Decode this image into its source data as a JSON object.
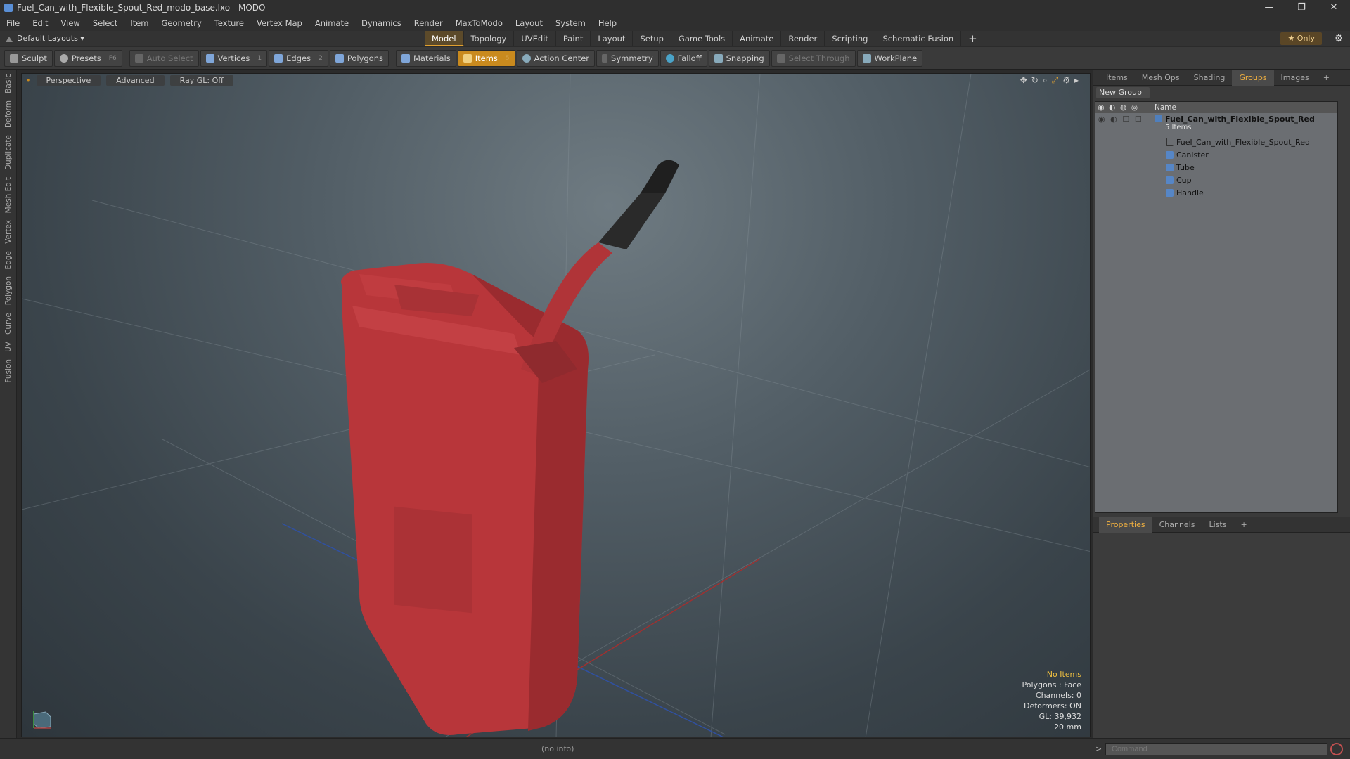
{
  "window": {
    "title": "Fuel_Can_with_Flexible_Spout_Red_modo_base.lxo - MODO",
    "minimize": "—",
    "restore": "❐",
    "close": "✕"
  },
  "menu": [
    "File",
    "Edit",
    "View",
    "Select",
    "Item",
    "Geometry",
    "Texture",
    "Vertex Map",
    "Animate",
    "Dynamics",
    "Render",
    "MaxToModo",
    "Layout",
    "System",
    "Help"
  ],
  "layoutbar": {
    "layout_dropdown": "Default Layouts ▾",
    "tabs": [
      "Model",
      "Topology",
      "UVEdit",
      "Paint",
      "Layout",
      "Setup",
      "Game Tools",
      "Animate",
      "Render",
      "Scripting",
      "Schematic Fusion"
    ],
    "active_tab": "Model",
    "add_tab": "+",
    "only_label": "★  Only",
    "gear": "⚙"
  },
  "toolbar": {
    "sculpt": "Sculpt",
    "presets": "Presets",
    "presets_key": "F6",
    "auto_select": "Auto Select",
    "vertices": "Vertices",
    "vertices_count": "1",
    "edges": "Edges",
    "edges_count": "2",
    "polygons": "Polygons",
    "materials": "Materials",
    "items": "Items",
    "items_count": "5",
    "action_center": "Action Center",
    "symmetry": "Symmetry",
    "falloff": "Falloff",
    "snapping": "Snapping",
    "select_through": "Select Through",
    "workplane": "WorkPlane"
  },
  "left_tabs": [
    "Basic",
    "Deform",
    "Duplicate",
    "Mesh Edit",
    "Vertex",
    "Edge",
    "Polygon",
    "Curve",
    "UV",
    "Fusion"
  ],
  "viewport": {
    "view_mode": "Perspective",
    "shading": "Advanced",
    "raygl": "Ray GL: Off",
    "info": {
      "no_items": "No Items",
      "polygons": "Polygons : Face",
      "channels": "Channels: 0",
      "deformers": "Deformers: ON",
      "gl": "GL: 39,932",
      "scale": "20 mm"
    }
  },
  "right_panel": {
    "tabs": [
      "Items",
      "Mesh Ops",
      "Shading",
      "Groups",
      "Images",
      "+"
    ],
    "active_tab": "Groups",
    "new_group": "New Group",
    "name_header": "Name",
    "root_group": "Fuel_Can_with_Flexible_Spout_Red",
    "root_sub": "5 Items",
    "children": [
      "Fuel_Can_with_Flexible_Spout_Red",
      "Canister",
      "Tube",
      "Cup",
      "Handle"
    ],
    "prop_tabs": [
      "Properties",
      "Channels",
      "Lists",
      "+"
    ],
    "prop_active": "Properties"
  },
  "status": {
    "info": "(no info)",
    "command_placeholder": "Command",
    "arrow": ">"
  },
  "colors": {
    "accent": "#e0a030",
    "can_red": "#c23a3a"
  }
}
